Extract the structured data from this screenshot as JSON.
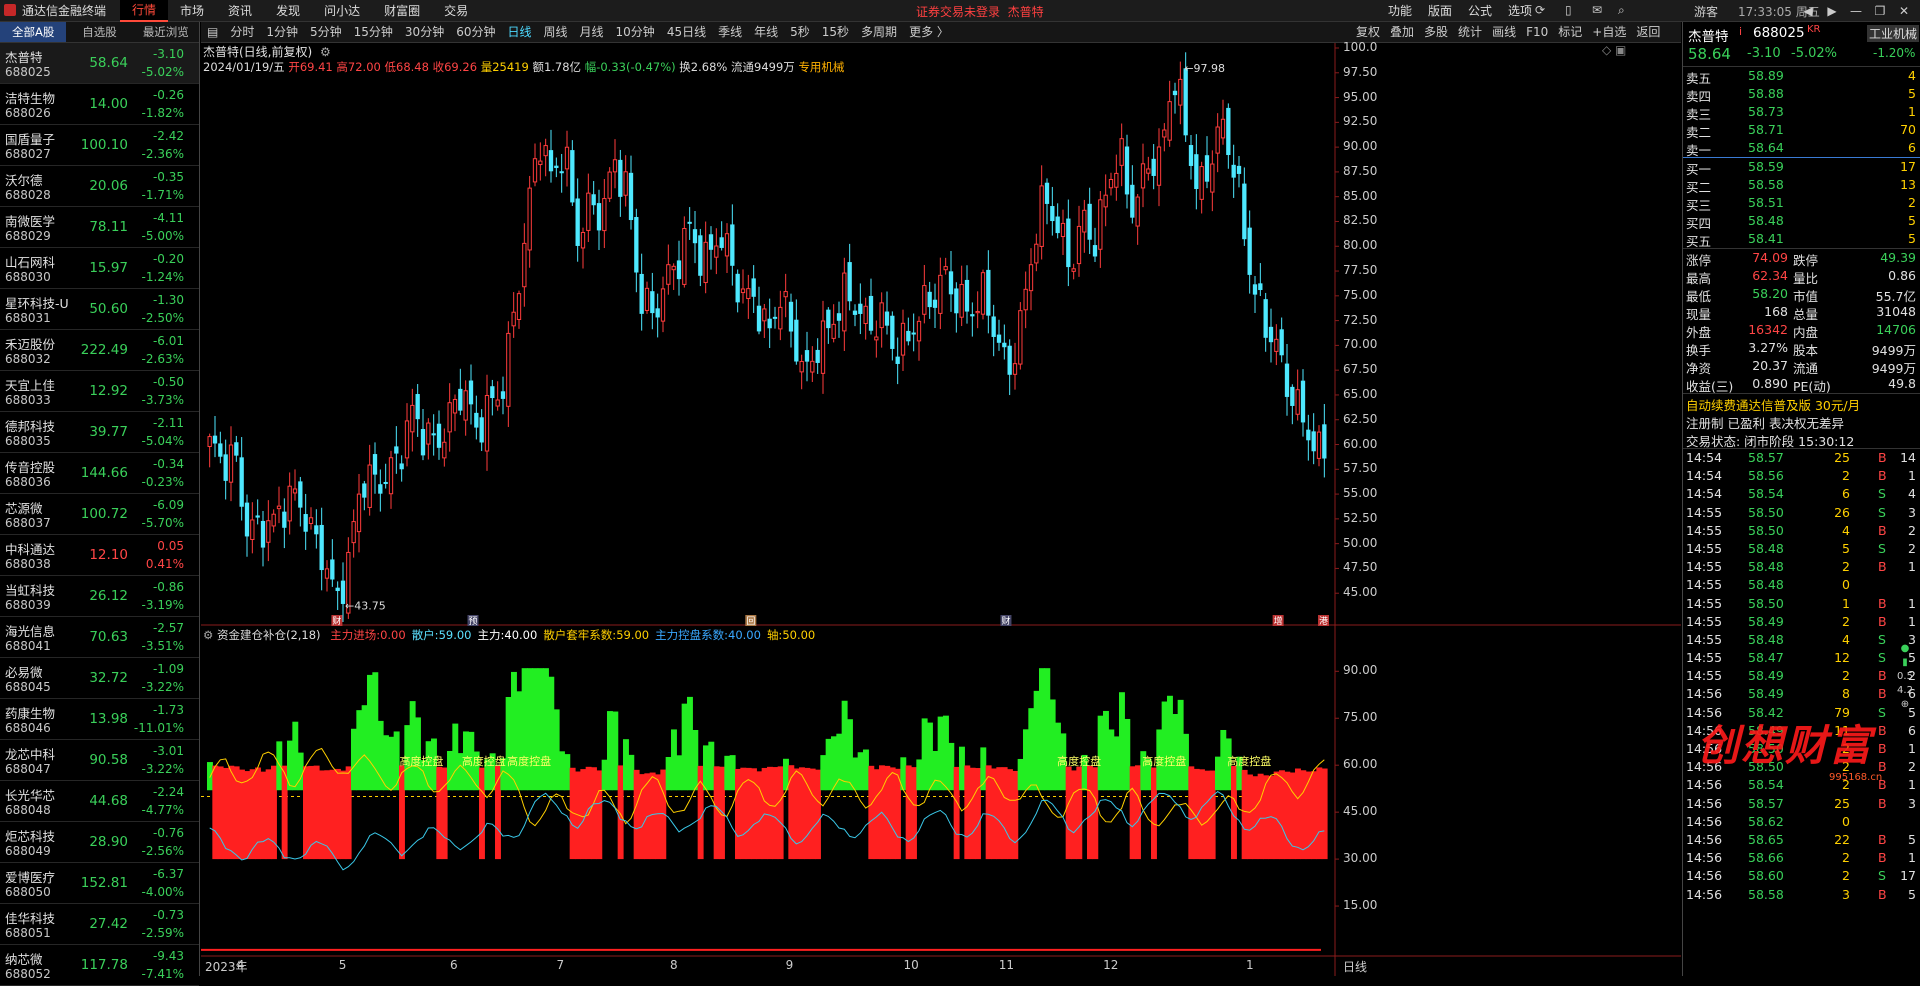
{
  "app": {
    "title": "通达信金融终端",
    "notice": "证券交易未登录",
    "notice_stock": "杰普特",
    "clock": "17:33:05 周五",
    "guest": "游客"
  },
  "main_menu": [
    "行情",
    "市场",
    "资讯",
    "发现",
    "问小达",
    "财富圈",
    "交易"
  ],
  "right_menu": [
    "功能",
    "版面",
    "公式",
    "选项"
  ],
  "window_buttons": [
    "◀",
    "▶",
    "—",
    "❐",
    "✕"
  ],
  "left_tabs": [
    "全部A股",
    "自选股",
    "最近浏览"
  ],
  "stocks": [
    {
      "name": "杰普特",
      "code": "688025",
      "price": "58.64",
      "change": "-3.10",
      "pct": "-5.02%",
      "dir": "down"
    },
    {
      "name": "洁特生物",
      "code": "688026",
      "price": "14.00",
      "change": "-0.26",
      "pct": "-1.82%",
      "dir": "down"
    },
    {
      "name": "国盾量子",
      "code": "688027",
      "price": "100.10",
      "change": "-2.42",
      "pct": "-2.36%",
      "dir": "down"
    },
    {
      "name": "沃尔德",
      "code": "688028",
      "price": "20.06",
      "change": "-0.35",
      "pct": "-1.71%",
      "dir": "down"
    },
    {
      "name": "南微医学",
      "code": "688029",
      "price": "78.11",
      "change": "-4.11",
      "pct": "-5.00%",
      "dir": "down"
    },
    {
      "name": "山石网科",
      "code": "688030",
      "price": "15.97",
      "change": "-0.20",
      "pct": "-1.24%",
      "dir": "down"
    },
    {
      "name": "星环科技-U",
      "code": "688031",
      "price": "50.60",
      "change": "-1.30",
      "pct": "-2.50%",
      "dir": "down"
    },
    {
      "name": "禾迈股份",
      "code": "688032",
      "price": "222.49",
      "change": "-6.01",
      "pct": "-2.63%",
      "dir": "down"
    },
    {
      "name": "天宜上佳",
      "code": "688033",
      "price": "12.92",
      "change": "-0.50",
      "pct": "-3.73%",
      "dir": "down"
    },
    {
      "name": "德邦科技",
      "code": "688035",
      "price": "39.77",
      "change": "-2.11",
      "pct": "-5.04%",
      "dir": "down"
    },
    {
      "name": "传音控股",
      "code": "688036",
      "price": "144.66",
      "change": "-0.34",
      "pct": "-0.23%",
      "dir": "down"
    },
    {
      "name": "芯源微",
      "code": "688037",
      "price": "100.72",
      "change": "-6.09",
      "pct": "-5.70%",
      "dir": "down"
    },
    {
      "name": "中科通达",
      "code": "688038",
      "price": "12.10",
      "change": "0.05",
      "pct": "0.41%",
      "dir": "up"
    },
    {
      "name": "当虹科技",
      "code": "688039",
      "price": "26.12",
      "change": "-0.86",
      "pct": "-3.19%",
      "dir": "down"
    },
    {
      "name": "海光信息",
      "code": "688041",
      "price": "70.63",
      "change": "-2.57",
      "pct": "-3.51%",
      "dir": "down"
    },
    {
      "name": "必易微",
      "code": "688045",
      "price": "32.72",
      "change": "-1.09",
      "pct": "-3.22%",
      "dir": "down"
    },
    {
      "name": "药康生物",
      "code": "688046",
      "price": "13.98",
      "change": "-1.73",
      "pct": "-11.01%",
      "dir": "down"
    },
    {
      "name": "龙芯中科",
      "code": "688047",
      "price": "90.58",
      "change": "-3.01",
      "pct": "-3.22%",
      "dir": "down"
    },
    {
      "name": "长光华芯",
      "code": "688048",
      "price": "44.68",
      "change": "-2.24",
      "pct": "-4.77%",
      "dir": "down"
    },
    {
      "name": "炬芯科技",
      "code": "688049",
      "price": "28.90",
      "change": "-0.76",
      "pct": "-2.56%",
      "dir": "down"
    },
    {
      "name": "爱博医疗",
      "code": "688050",
      "price": "152.81",
      "change": "-6.37",
      "pct": "-4.00%",
      "dir": "down"
    },
    {
      "name": "佳华科技",
      "code": "688051",
      "price": "27.42",
      "change": "-0.73",
      "pct": "-2.59%",
      "dir": "down"
    },
    {
      "name": "纳芯微",
      "code": "688052",
      "price": "117.78",
      "change": "-9.43",
      "pct": "-7.41%",
      "dir": "down"
    }
  ],
  "periods": [
    "分时",
    "1分钟",
    "5分钟",
    "15分钟",
    "30分钟",
    "60分钟",
    "日线",
    "周线",
    "月线",
    "10分钟",
    "45日线",
    "季线",
    "年线",
    "5秒",
    "15秒",
    "多周期",
    "更多 〉"
  ],
  "active_period": "日线",
  "toolbar_right": [
    "复权",
    "叠加",
    "多股",
    "统计",
    "画线",
    "F10",
    "标记",
    "+自选",
    "返回"
  ],
  "chart_header": {
    "title": "杰普特(日线,前复权)",
    "date": "2024/01/19/五",
    "open": "开69.41",
    "high": "高72.00",
    "low": "低68.48",
    "close": "收69.26",
    "volume": "量25419",
    "amount": "额1.78亿",
    "amp": "幅-0.33(-0.47%)",
    "turnover": "换2.68%",
    "float": "流通9499万",
    "industry": "专用机械"
  },
  "indicator": {
    "name": "资金建仓补仓(2,18)",
    "items": [
      {
        "label": "主力进场:",
        "value": "0.00",
        "color": "#ff4545"
      },
      {
        "label": "散户:",
        "value": "59.00",
        "color": "#5ce0ff"
      },
      {
        "label": "主力:",
        "value": "40.00",
        "color": "#ffffff"
      },
      {
        "label": "散户套牢系数:",
        "value": "59.00",
        "color": "#ffd000"
      },
      {
        "label": "主力控盘系数:",
        "value": "40.00",
        "color": "#3aa8ff"
      },
      {
        "label": "轴:",
        "value": "50.00",
        "color": "#ffd000"
      }
    ],
    "texts": [
      "高度控盘",
      "高度控盘",
      "高度控盘",
      "高度控盘",
      "高度控盘",
      "高度控盘"
    ]
  },
  "markers": [
    "财",
    "预",
    "回",
    "财",
    "增",
    "港"
  ],
  "price_axis": [
    "100.0",
    "97.50",
    "95.00",
    "92.50",
    "90.00",
    "87.50",
    "85.00",
    "82.50",
    "80.00",
    "77.50",
    "75.00",
    "72.50",
    "70.00",
    "67.50",
    "65.00",
    "62.50",
    "60.00",
    "57.50",
    "55.00",
    "52.50",
    "50.00",
    "47.50",
    "45.00"
  ],
  "ind_axis": [
    "90.00",
    "75.00",
    "60.00",
    "45.00",
    "30.00",
    "15.00"
  ],
  "date_axis": [
    "2023年",
    "4",
    "5",
    "6",
    "7",
    "8",
    "9",
    "10",
    "11",
    "12",
    "1",
    "日线"
  ],
  "max_label": "97.98",
  "min_label": "43.75",
  "chart_data": {
    "type": "candlestick",
    "ylim": [
      42.5,
      100
    ],
    "ticks": [
      "100.0",
      "97.50",
      "95.00",
      "92.50",
      "90.00",
      "87.50",
      "85.00",
      "82.50",
      "80.00",
      "77.50",
      "75.00",
      "72.50",
      "70.00",
      "67.50",
      "65.00",
      "62.50",
      "60.00",
      "57.50",
      "55.00",
      "52.50",
      "50.00",
      "47.50",
      "45.00"
    ],
    "anchors_close": [
      60,
      57,
      58,
      52,
      53,
      52,
      53,
      54,
      52,
      50,
      44,
      47,
      56,
      57,
      58,
      59,
      62,
      60,
      61,
      64,
      66,
      60,
      63,
      66,
      74,
      82,
      90,
      86,
      91,
      82,
      84,
      82,
      88,
      86,
      76,
      73,
      75,
      78,
      83,
      79,
      81,
      78,
      74,
      76,
      72,
      75,
      70,
      66,
      71,
      73,
      75,
      73,
      71,
      74,
      71,
      70,
      72,
      74,
      78,
      76,
      73,
      74,
      71,
      68,
      73,
      80,
      84,
      81,
      79,
      84,
      80,
      86,
      88,
      84,
      90,
      88,
      96,
      92,
      86,
      90,
      92,
      86,
      78,
      74,
      72,
      66,
      62,
      60,
      58.64
    ],
    "max": 97.98,
    "min": 43.75
  },
  "quote": {
    "name": "杰普特",
    "code": "688025",
    "tag": "KR",
    "industry": "工业机械",
    "price": "58.64",
    "change": "-3.10",
    "pct": "-5.02%",
    "ind_pct": "-1.20%",
    "asks": [
      {
        "label": "卖五",
        "price": "58.89",
        "vol": "4"
      },
      {
        "label": "卖四",
        "price": "58.88",
        "vol": "5"
      },
      {
        "label": "卖三",
        "price": "58.73",
        "vol": "1"
      },
      {
        "label": "卖二",
        "price": "58.71",
        "vol": "70"
      },
      {
        "label": "卖一",
        "price": "58.64",
        "vol": "6"
      }
    ],
    "bids": [
      {
        "label": "买一",
        "price": "58.59",
        "vol": "17"
      },
      {
        "label": "买二",
        "price": "58.58",
        "vol": "13"
      },
      {
        "label": "买三",
        "price": "58.51",
        "vol": "2"
      },
      {
        "label": "买四",
        "price": "58.48",
        "vol": "5"
      },
      {
        "label": "买五",
        "price": "58.41",
        "vol": "5"
      }
    ],
    "stats": [
      [
        "涨停",
        "74.09",
        "red",
        "跌停",
        "49.39",
        "grn"
      ],
      [
        "最高",
        "62.34",
        "red",
        "量比",
        "0.86",
        "wht"
      ],
      [
        "最低",
        "58.20",
        "grn",
        "市值",
        "55.7亿",
        "wht"
      ],
      [
        "现量",
        "168",
        "wht",
        "总量",
        "31048",
        "wht"
      ],
      [
        "外盘",
        "16342",
        "red",
        "内盘",
        "14706",
        "grn"
      ],
      [
        "换手",
        "3.27%",
        "wht",
        "股本",
        "9499万",
        "wht"
      ],
      [
        "净资",
        "20.37",
        "wht",
        "流通",
        "9499万",
        "wht"
      ],
      [
        "收益(三)",
        "0.890",
        "wht",
        "PE(动)",
        "49.8",
        "wht"
      ]
    ],
    "promo": "自动续费通达信普及版  30元/月",
    "reg": "注册制  已盈利  表决权无差异",
    "trade_state": "交易状态: 闭市阶段 15:30:12"
  },
  "ticks": [
    [
      "14:54",
      "58.57",
      "25",
      "B",
      "14"
    ],
    [
      "14:54",
      "58.56",
      "2",
      "B",
      "1"
    ],
    [
      "14:54",
      "58.54",
      "6",
      "S",
      "4"
    ],
    [
      "14:55",
      "58.50",
      "26",
      "S",
      "3"
    ],
    [
      "14:55",
      "58.50",
      "4",
      "B",
      "2"
    ],
    [
      "14:55",
      "58.48",
      "5",
      "S",
      "2"
    ],
    [
      "14:55",
      "58.48",
      "2",
      "B",
      "1"
    ],
    [
      "14:55",
      "58.48",
      "0",
      "",
      ""
    ],
    [
      "14:55",
      "58.50",
      "1",
      "B",
      "1"
    ],
    [
      "14:55",
      "58.49",
      "2",
      "B",
      "1"
    ],
    [
      "14:55",
      "58.48",
      "4",
      "S",
      "3"
    ],
    [
      "14:55",
      "58.47",
      "12",
      "S",
      "5"
    ],
    [
      "14:55",
      "58.49",
      "2",
      "B",
      "2"
    ],
    [
      "14:56",
      "58.49",
      "8",
      "B",
      "6"
    ],
    [
      "14:56",
      "58.42",
      "79",
      "S",
      "5"
    ],
    [
      "14:56",
      "58.49",
      "11",
      "B",
      "6"
    ],
    [
      "14:56",
      "58.50",
      "2",
      "B",
      "1"
    ],
    [
      "14:56",
      "58.50",
      "2",
      "B",
      "2"
    ],
    [
      "14:56",
      "58.54",
      "2",
      "B",
      "1"
    ],
    [
      "14:56",
      "58.57",
      "25",
      "B",
      "3"
    ],
    [
      "14:56",
      "58.62",
      "0",
      "",
      ""
    ],
    [
      "14:56",
      "58.65",
      "22",
      "B",
      "5"
    ],
    [
      "14:56",
      "58.66",
      "2",
      "B",
      "1"
    ],
    [
      "14:56",
      "58.60",
      "2",
      "S",
      "17"
    ],
    [
      "14:56",
      "58.58",
      "3",
      "B",
      "5"
    ]
  ],
  "watermark": "创想财富",
  "watermark_url": "995168.cn",
  "colors": {
    "up": "#ff3c3c",
    "down": "#4ee8ff",
    "accent": "#ff4a3a"
  }
}
